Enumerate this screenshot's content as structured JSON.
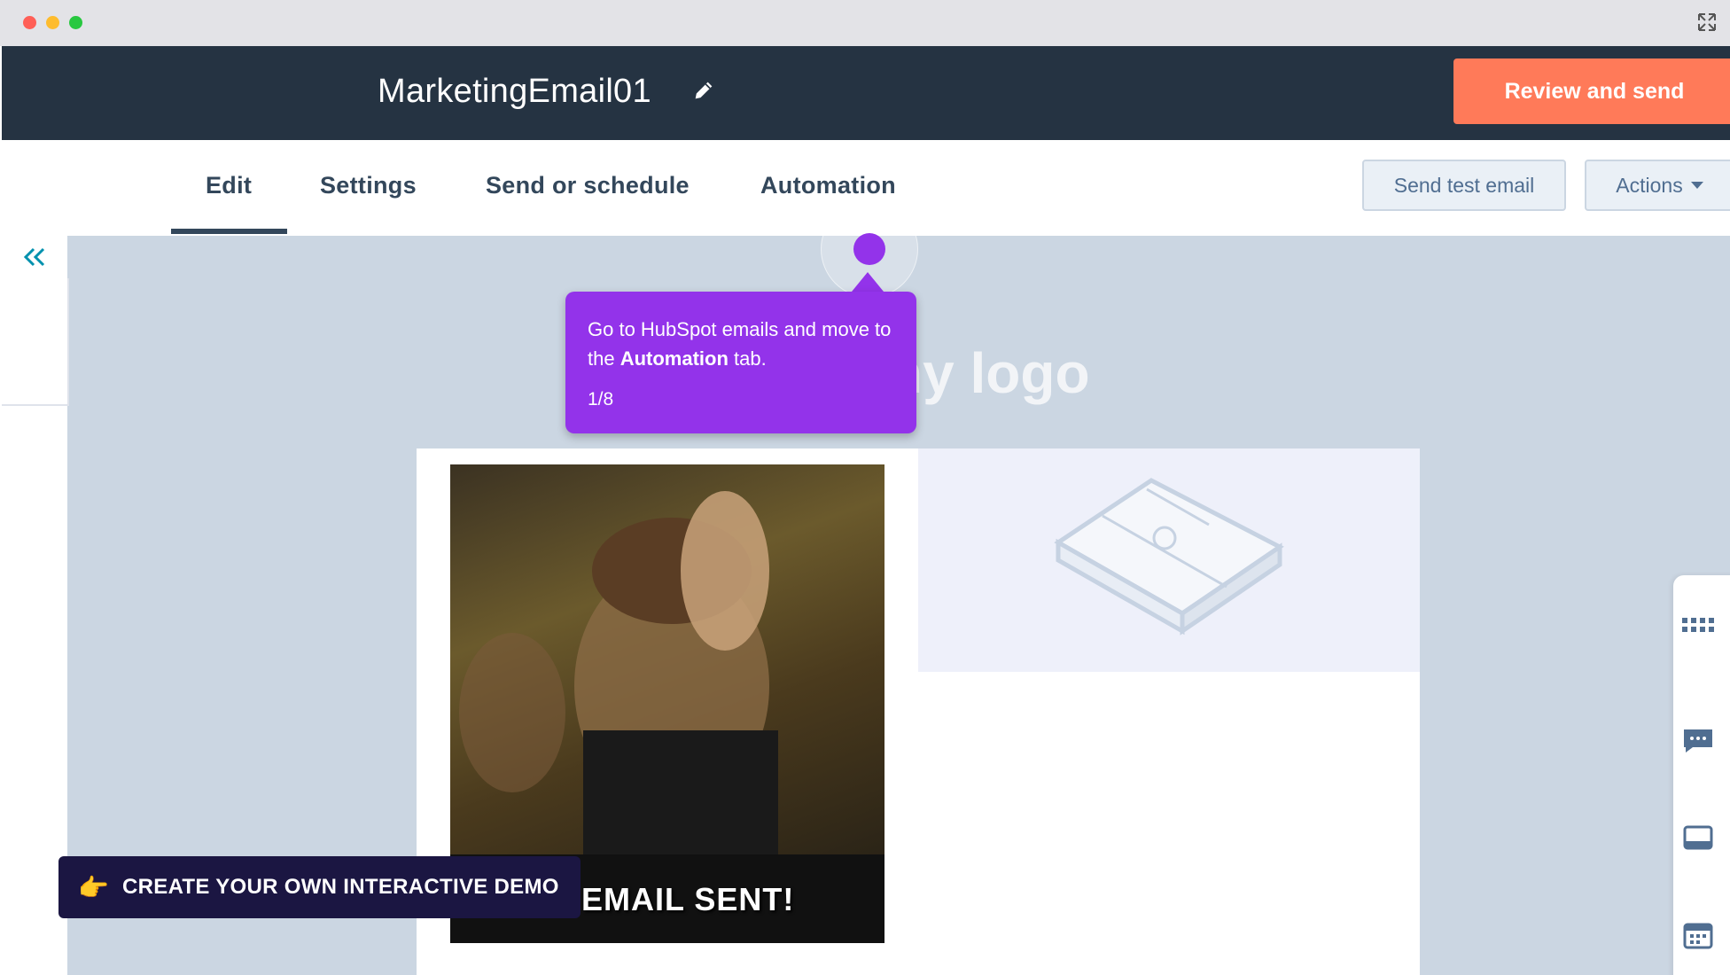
{
  "email": {
    "title": "MarketingEmail01"
  },
  "header": {
    "review_send_label": "Review and send"
  },
  "tabs": [
    {
      "label": "Edit"
    },
    {
      "label": "Settings"
    },
    {
      "label": "Send or schedule"
    },
    {
      "label": "Automation"
    }
  ],
  "toolbar": {
    "send_test_label": "Send test email",
    "actions_label": "Actions"
  },
  "canvas": {
    "logo_text": "ny logo",
    "gif_caption": "EMAIL SENT!"
  },
  "tour": {
    "tooltip_prefix": "Go to HubSpot emails and move to the ",
    "tooltip_bold": "Automation",
    "tooltip_suffix": " tab.",
    "step": "1/8"
  },
  "demo_banner": {
    "emoji": "👉",
    "label": "CREATE YOUR OWN INTERACTIVE DEMO"
  },
  "colors": {
    "header_bg": "#253342",
    "primary_button": "#ff7a59",
    "tour_accent": "#9333ea",
    "banner_bg": "#1b1642"
  },
  "icons": [
    "expand-icon",
    "pencil-icon",
    "caret-down-icon",
    "double-chevron-left-icon",
    "gift-box-icon",
    "grid-icon",
    "chat-icon",
    "window-icon",
    "calendar-icon"
  ]
}
